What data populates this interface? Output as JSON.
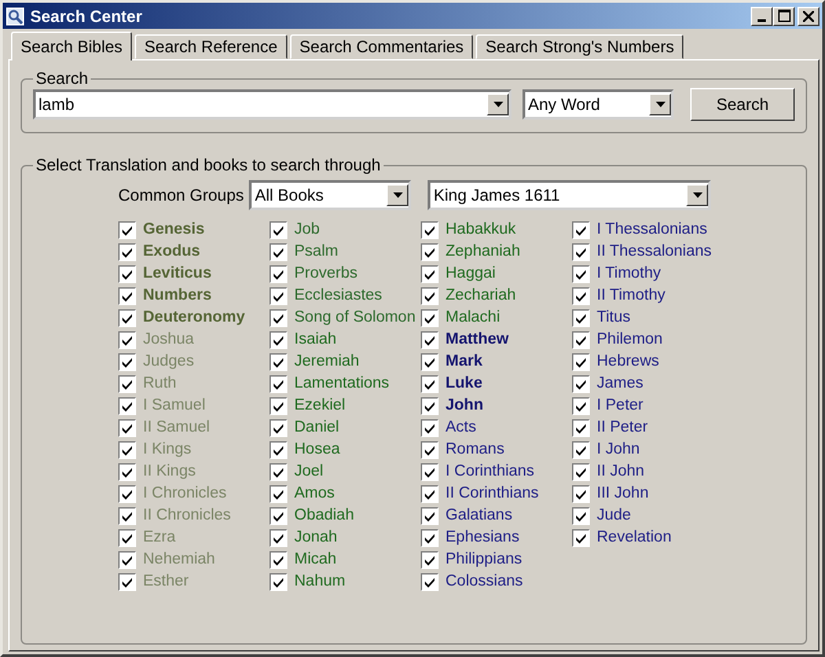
{
  "window": {
    "title": "Search Center"
  },
  "tabs": [
    {
      "label": "Search Bibles",
      "selected": true
    },
    {
      "label": "Search Reference",
      "selected": false
    },
    {
      "label": "Search Commentaries",
      "selected": false
    },
    {
      "label": "Search Strong's Numbers",
      "selected": false
    }
  ],
  "search": {
    "legend": "Search",
    "value": "lamb",
    "mode": "Any Word",
    "button": "Search"
  },
  "books_group": {
    "legend": "Select Translation and books to search through",
    "groups_label": "Common Groups",
    "groups_value": "All Books",
    "translation": "King James 1611",
    "columns": [
      [
        {
          "name": "Genesis",
          "checked": true,
          "kind": "main",
          "color": "#556535"
        },
        {
          "name": "Exodus",
          "checked": true,
          "kind": "main",
          "color": "#556535"
        },
        {
          "name": "Leviticus",
          "checked": true,
          "kind": "main",
          "color": "#556535"
        },
        {
          "name": "Numbers",
          "checked": true,
          "kind": "main",
          "color": "#556535"
        },
        {
          "name": "Deuteronomy",
          "checked": true,
          "kind": "main",
          "color": "#556535"
        },
        {
          "name": "Joshua",
          "checked": true,
          "kind": "plain",
          "color": "#7b8566"
        },
        {
          "name": "Judges",
          "checked": true,
          "kind": "plain",
          "color": "#7b8566"
        },
        {
          "name": "Ruth",
          "checked": true,
          "kind": "plain",
          "color": "#7b8566"
        },
        {
          "name": "I Samuel",
          "checked": true,
          "kind": "plain",
          "color": "#7b8566"
        },
        {
          "name": "II Samuel",
          "checked": true,
          "kind": "plain",
          "color": "#7b8566"
        },
        {
          "name": "I Kings",
          "checked": true,
          "kind": "plain",
          "color": "#7b8566"
        },
        {
          "name": "II Kings",
          "checked": true,
          "kind": "plain",
          "color": "#7b8566"
        },
        {
          "name": "I Chronicles",
          "checked": true,
          "kind": "plain",
          "color": "#7b8566"
        },
        {
          "name": "II Chronicles",
          "checked": true,
          "kind": "plain",
          "color": "#7b8566"
        },
        {
          "name": "Ezra",
          "checked": true,
          "kind": "plain",
          "color": "#7b8566"
        },
        {
          "name": "Nehemiah",
          "checked": true,
          "kind": "plain",
          "color": "#7b8566"
        },
        {
          "name": "Esther",
          "checked": true,
          "kind": "plain",
          "color": "#7b8566"
        }
      ],
      [
        {
          "name": "Job",
          "checked": true,
          "kind": "plain",
          "color": "#2d6a2d"
        },
        {
          "name": "Psalm",
          "checked": true,
          "kind": "plain",
          "color": "#2d6a2d"
        },
        {
          "name": "Proverbs",
          "checked": true,
          "kind": "plain",
          "color": "#2d6a2d"
        },
        {
          "name": "Ecclesiastes",
          "checked": true,
          "kind": "plain",
          "color": "#2d6a2d"
        },
        {
          "name": "Song of Solomon",
          "checked": true,
          "kind": "plain",
          "color": "#2d6a2d"
        },
        {
          "name": "Isaiah",
          "checked": true,
          "kind": "plain",
          "color": "#1f6a1f"
        },
        {
          "name": "Jeremiah",
          "checked": true,
          "kind": "plain",
          "color": "#1f6a1f"
        },
        {
          "name": "Lamentations",
          "checked": true,
          "kind": "plain",
          "color": "#1f6a1f"
        },
        {
          "name": "Ezekiel",
          "checked": true,
          "kind": "plain",
          "color": "#1f6a1f"
        },
        {
          "name": "Daniel",
          "checked": true,
          "kind": "plain",
          "color": "#1f6a1f"
        },
        {
          "name": "Hosea",
          "checked": true,
          "kind": "plain",
          "color": "#1f6a1f"
        },
        {
          "name": "Joel",
          "checked": true,
          "kind": "plain",
          "color": "#1f6a1f"
        },
        {
          "name": "Amos",
          "checked": true,
          "kind": "plain",
          "color": "#1f6a1f"
        },
        {
          "name": "Obadiah",
          "checked": true,
          "kind": "plain",
          "color": "#1f6a1f"
        },
        {
          "name": "Jonah",
          "checked": true,
          "kind": "plain",
          "color": "#1f6a1f"
        },
        {
          "name": "Micah",
          "checked": true,
          "kind": "plain",
          "color": "#1f6a1f"
        },
        {
          "name": "Nahum",
          "checked": true,
          "kind": "plain",
          "color": "#1f6a1f"
        }
      ],
      [
        {
          "name": "Habakkuk",
          "checked": true,
          "kind": "plain",
          "color": "#1f6a1f"
        },
        {
          "name": "Zephaniah",
          "checked": true,
          "kind": "plain",
          "color": "#1f6a1f"
        },
        {
          "name": "Haggai",
          "checked": true,
          "kind": "plain",
          "color": "#1f6a1f"
        },
        {
          "name": "Zechariah",
          "checked": true,
          "kind": "plain",
          "color": "#1f6a1f"
        },
        {
          "name": "Malachi",
          "checked": true,
          "kind": "plain",
          "color": "#1f6a1f"
        },
        {
          "name": "Matthew",
          "checked": true,
          "kind": "main",
          "color": "#14146e"
        },
        {
          "name": "Mark",
          "checked": true,
          "kind": "main",
          "color": "#14146e"
        },
        {
          "name": "Luke",
          "checked": true,
          "kind": "main",
          "color": "#14146e"
        },
        {
          "name": "John",
          "checked": true,
          "kind": "main",
          "color": "#14146e"
        },
        {
          "name": "Acts",
          "checked": true,
          "kind": "plain",
          "color": "#1e1e86"
        },
        {
          "name": "Romans",
          "checked": true,
          "kind": "plain",
          "color": "#1e1e86"
        },
        {
          "name": "I Corinthians",
          "checked": true,
          "kind": "plain",
          "color": "#1e1e86"
        },
        {
          "name": "II Corinthians",
          "checked": true,
          "kind": "plain",
          "color": "#1e1e86"
        },
        {
          "name": "Galatians",
          "checked": true,
          "kind": "plain",
          "color": "#1e1e86"
        },
        {
          "name": "Ephesians",
          "checked": true,
          "kind": "plain",
          "color": "#1e1e86"
        },
        {
          "name": "Philippians",
          "checked": true,
          "kind": "plain",
          "color": "#1e1e86"
        },
        {
          "name": "Colossians",
          "checked": true,
          "kind": "plain",
          "color": "#1e1e86"
        }
      ],
      [
        {
          "name": "I Thessalonians",
          "checked": true,
          "kind": "plain",
          "color": "#1e1e86"
        },
        {
          "name": "II Thessalonians",
          "checked": true,
          "kind": "plain",
          "color": "#1e1e86"
        },
        {
          "name": "I Timothy",
          "checked": true,
          "kind": "plain",
          "color": "#1e1e86"
        },
        {
          "name": "II Timothy",
          "checked": true,
          "kind": "plain",
          "color": "#1e1e86"
        },
        {
          "name": "Titus",
          "checked": true,
          "kind": "plain",
          "color": "#1e1e86"
        },
        {
          "name": "Philemon",
          "checked": true,
          "kind": "plain",
          "color": "#1e1e86"
        },
        {
          "name": "Hebrews",
          "checked": true,
          "kind": "plain",
          "color": "#1e1e86"
        },
        {
          "name": "James",
          "checked": true,
          "kind": "plain",
          "color": "#1e1e86"
        },
        {
          "name": "I Peter",
          "checked": true,
          "kind": "plain",
          "color": "#1e1e86"
        },
        {
          "name": "II Peter",
          "checked": true,
          "kind": "plain",
          "color": "#1e1e86"
        },
        {
          "name": "I John",
          "checked": true,
          "kind": "plain",
          "color": "#1e1e86"
        },
        {
          "name": "II John",
          "checked": true,
          "kind": "plain",
          "color": "#1e1e86"
        },
        {
          "name": "III John",
          "checked": true,
          "kind": "plain",
          "color": "#1e1e86"
        },
        {
          "name": "Jude",
          "checked": true,
          "kind": "plain",
          "color": "#1e1e86"
        },
        {
          "name": "Revelation",
          "checked": true,
          "kind": "plain",
          "color": "#1e1e86"
        }
      ]
    ]
  }
}
